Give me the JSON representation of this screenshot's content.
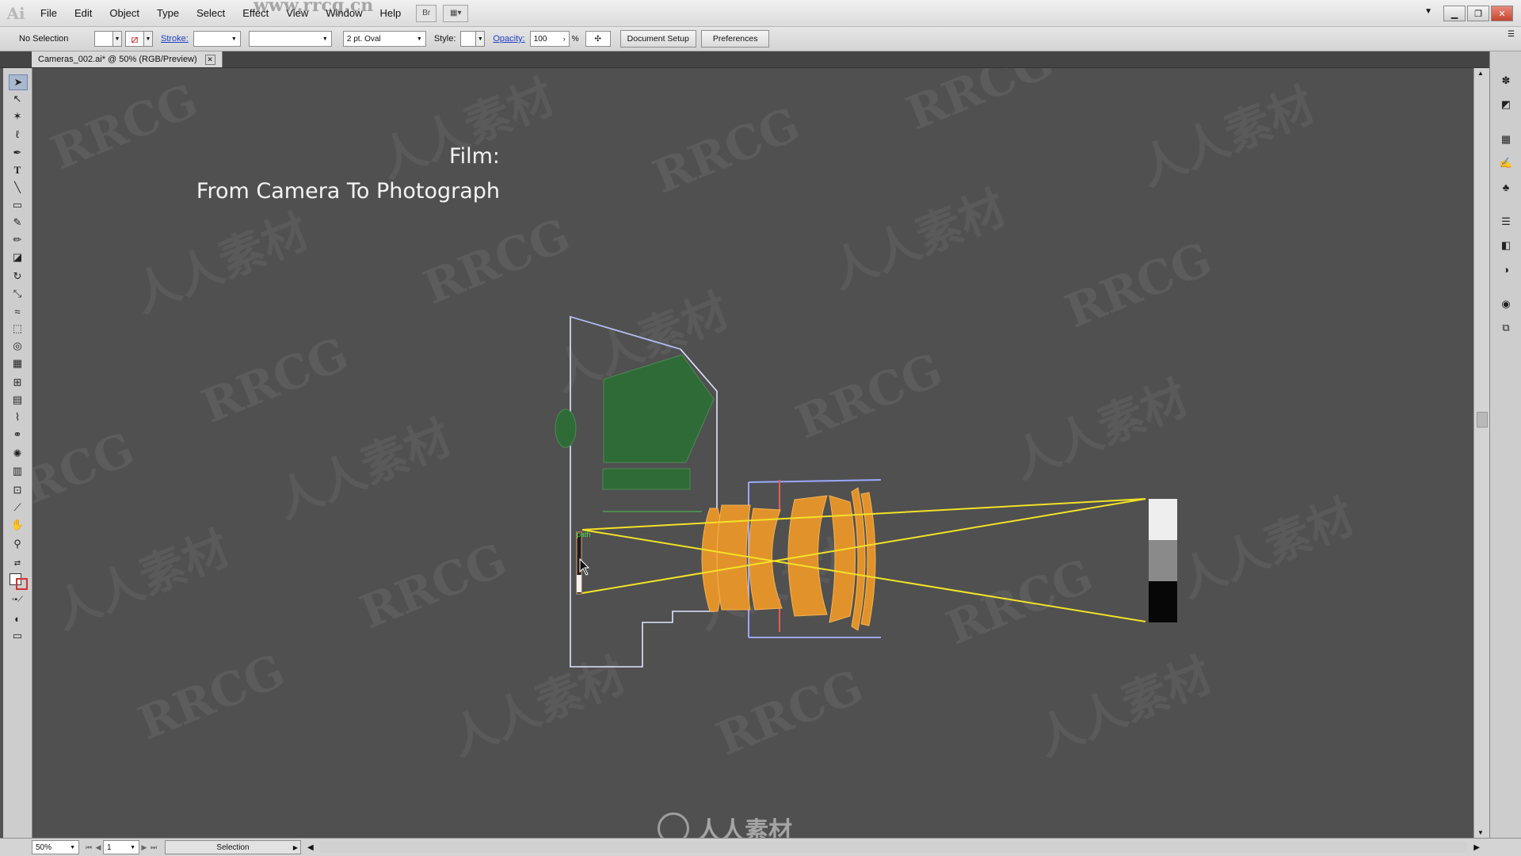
{
  "app": {
    "logo": "Ai",
    "menus": [
      "File",
      "Edit",
      "Object",
      "Type",
      "Select",
      "Effect",
      "View",
      "Window",
      "Help"
    ],
    "bridge_button": "Br",
    "window_controls": [
      "minimize",
      "restore",
      "close"
    ]
  },
  "control_bar": {
    "selection_label": "No Selection",
    "stroke_label": "Stroke:",
    "brush_label": "2 pt. Oval",
    "style_label": "Style:",
    "opacity_label": "Opacity:",
    "opacity_value": "100",
    "opacity_unit": "%",
    "document_setup_button": "Document Setup",
    "preferences_button": "Preferences"
  },
  "document_tab": {
    "title": "Cameras_002.ai* @ 50% (RGB/Preview)"
  },
  "artboard": {
    "heading_line1": "Film:",
    "heading_line2": "From Camera To Photograph",
    "hover_label": "path"
  },
  "status_bar": {
    "zoom": "50%",
    "page": "1",
    "tool_status": "Selection"
  },
  "watermarks": {
    "top": "www.rrcg.cn",
    "repeat_latin": "RRCG",
    "repeat_cjk": "人人素材",
    "bottom": "人人素材"
  },
  "colors": {
    "canvas": "#505050",
    "lens": "#e2922a",
    "viewfinder": "#2f6b36",
    "light_ray": "#f3e227"
  }
}
